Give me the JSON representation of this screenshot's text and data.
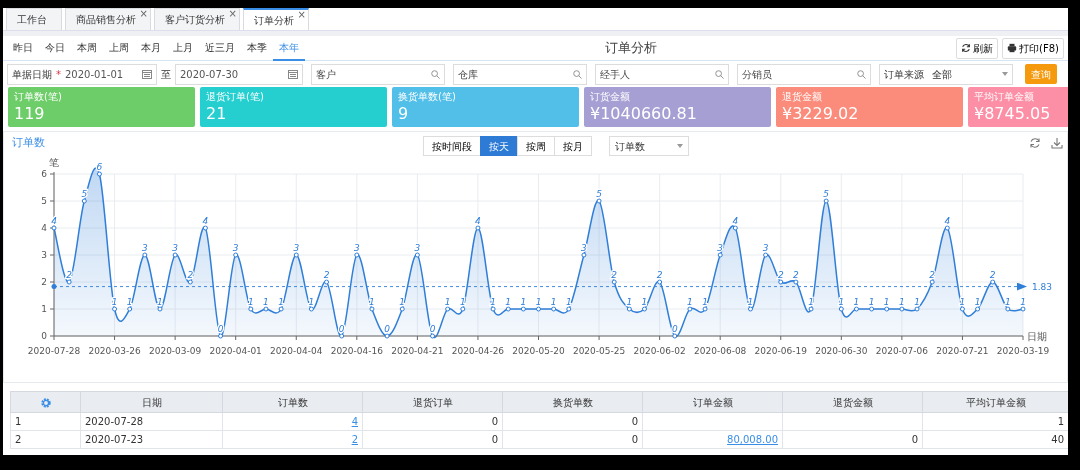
{
  "tabs": [
    {
      "label": "工作台",
      "selected": false
    },
    {
      "label": "商品销售分析",
      "close": "×",
      "selected": false
    },
    {
      "label": "客户订货分析",
      "close": "×",
      "selected": false
    },
    {
      "label": "订单分析",
      "close": "×",
      "selected": true
    }
  ],
  "periods": [
    {
      "label": "昨日",
      "selected": false
    },
    {
      "label": "今日",
      "selected": false
    },
    {
      "label": "本周",
      "selected": false
    },
    {
      "label": "上周",
      "selected": false
    },
    {
      "label": "本月",
      "selected": false
    },
    {
      "label": "上月",
      "selected": false
    },
    {
      "label": "近三月",
      "selected": false
    },
    {
      "label": "本季",
      "selected": false
    },
    {
      "label": "本年",
      "selected": true
    }
  ],
  "page_title": "订单分析",
  "toolbar": [
    {
      "kind": "refresh",
      "label": "刷新"
    },
    {
      "kind": "print",
      "label": "打印(F8)"
    }
  ],
  "filters": {
    "date": {
      "label": "单据日期",
      "required_mark": "*",
      "from": "2020-01-01",
      "separator": "至",
      "to": "2020-07-30"
    },
    "searches": [
      {
        "placeholder": "客户"
      },
      {
        "placeholder": "仓库"
      },
      {
        "placeholder": "经手人"
      },
      {
        "placeholder": "分销员"
      }
    ],
    "source": {
      "label": "订单来源",
      "value": "全部"
    },
    "query_button": "查询"
  },
  "stats": [
    {
      "label": "订单数(笔)",
      "value": "119",
      "color": "#6dcd69"
    },
    {
      "label": "退货订单(笔)",
      "value": "21",
      "color": "#26cfcf"
    },
    {
      "label": "换货单数(笔)",
      "value": "9",
      "color": "#51bfe7"
    },
    {
      "label": "订货金额",
      "value": "¥1040660.81",
      "color": "#a69fd3"
    },
    {
      "label": "退货金额",
      "value": "¥3229.02",
      "color": "#fb8c7b"
    },
    {
      "label": "平均订单金额",
      "value": "¥8745.05",
      "color": "#fc8fa5"
    }
  ],
  "chart_panel": {
    "title": "订单数",
    "modes": [
      {
        "label": "按时间段",
        "selected": false
      },
      {
        "label": "按天",
        "selected": true
      },
      {
        "label": "按周",
        "selected": false
      },
      {
        "label": "按月",
        "selected": false
      }
    ],
    "metric": "订单数",
    "chart_data": {
      "type": "area",
      "xlabel": "日期",
      "ylabel": "笔",
      "categories": [
        "2020-07-28",
        null,
        null,
        null,
        "2020-03-26",
        null,
        null,
        null,
        "2020-03-09",
        null,
        null,
        null,
        "2020-04-01",
        null,
        null,
        null,
        "2020-04-04",
        null,
        null,
        null,
        "2020-04-16",
        null,
        null,
        null,
        "2020-04-21",
        null,
        null,
        null,
        "2020-04-26",
        null,
        null,
        null,
        "2020-05-20",
        null,
        null,
        null,
        "2020-05-25",
        null,
        null,
        null,
        "2020-06-02",
        null,
        null,
        null,
        "2020-06-08",
        null,
        null,
        null,
        "2020-06-19",
        null,
        null,
        null,
        "2020-06-30",
        null,
        null,
        null,
        "2020-07-06",
        null,
        null,
        null,
        "2020-07-21",
        null,
        null,
        null,
        "2020-03-19"
      ],
      "series": [
        {
          "color": "#2f7ed8",
          "values": [
            4,
            2,
            5,
            6,
            1,
            1,
            3,
            1,
            3,
            2,
            4,
            0,
            3,
            1,
            1,
            1,
            3,
            1,
            2,
            0,
            3,
            1,
            0,
            1,
            3,
            0,
            1,
            1,
            4,
            1,
            1,
            1,
            1,
            1,
            1,
            3,
            5,
            2,
            1,
            1,
            2,
            0,
            1,
            1,
            3,
            4,
            1,
            3,
            2,
            2,
            1,
            5,
            1,
            1,
            1,
            1,
            1,
            1,
            2,
            4,
            1,
            1,
            2,
            1,
            1
          ]
        }
      ],
      "ylim": [
        0,
        6
      ],
      "yticks": [
        0,
        1,
        2,
        3,
        4,
        5,
        6
      ],
      "grid": true,
      "data_labels": true,
      "ref_lines": [
        {
          "axis": "y",
          "value": 1.83,
          "label": "1.83"
        }
      ]
    }
  },
  "table": {
    "columns": [
      "日期",
      "订单数",
      "退货订单",
      "换货单数",
      "订单金额",
      "退货金额",
      "平均订单金额"
    ],
    "rows": [
      {
        "index": "1",
        "cells": [
          "2020-07-28",
          "4",
          "0",
          "0",
          null,
          null,
          "1"
        ]
      },
      {
        "index": "2",
        "cells": [
          "2020-07-23",
          "2",
          "0",
          "0",
          "80,008.00",
          "0",
          "40"
        ]
      }
    ]
  }
}
